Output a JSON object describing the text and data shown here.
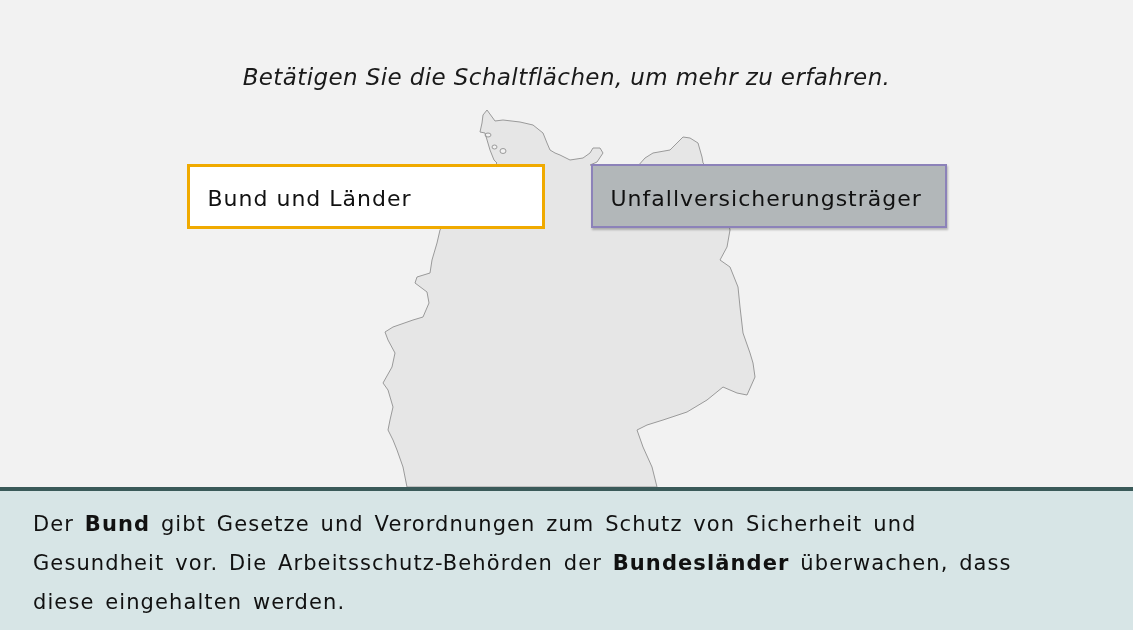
{
  "instruction": "Betätigen Sie die Schaltflächen, um mehr zu erfahren.",
  "buttons": [
    {
      "label": "Bund und Länder",
      "selected": true
    },
    {
      "label": "Unfallversicherungsträger",
      "selected": false
    }
  ],
  "info_panel": {
    "text": "Der **Bund** gibt Gesetze und Verordnungen zum Schutz von Sicherheit und Gesundheit vor. Die Arbeitsschutz-Behörden der **Bundesländer** überwachen, dass diese eingehalten werden."
  }
}
